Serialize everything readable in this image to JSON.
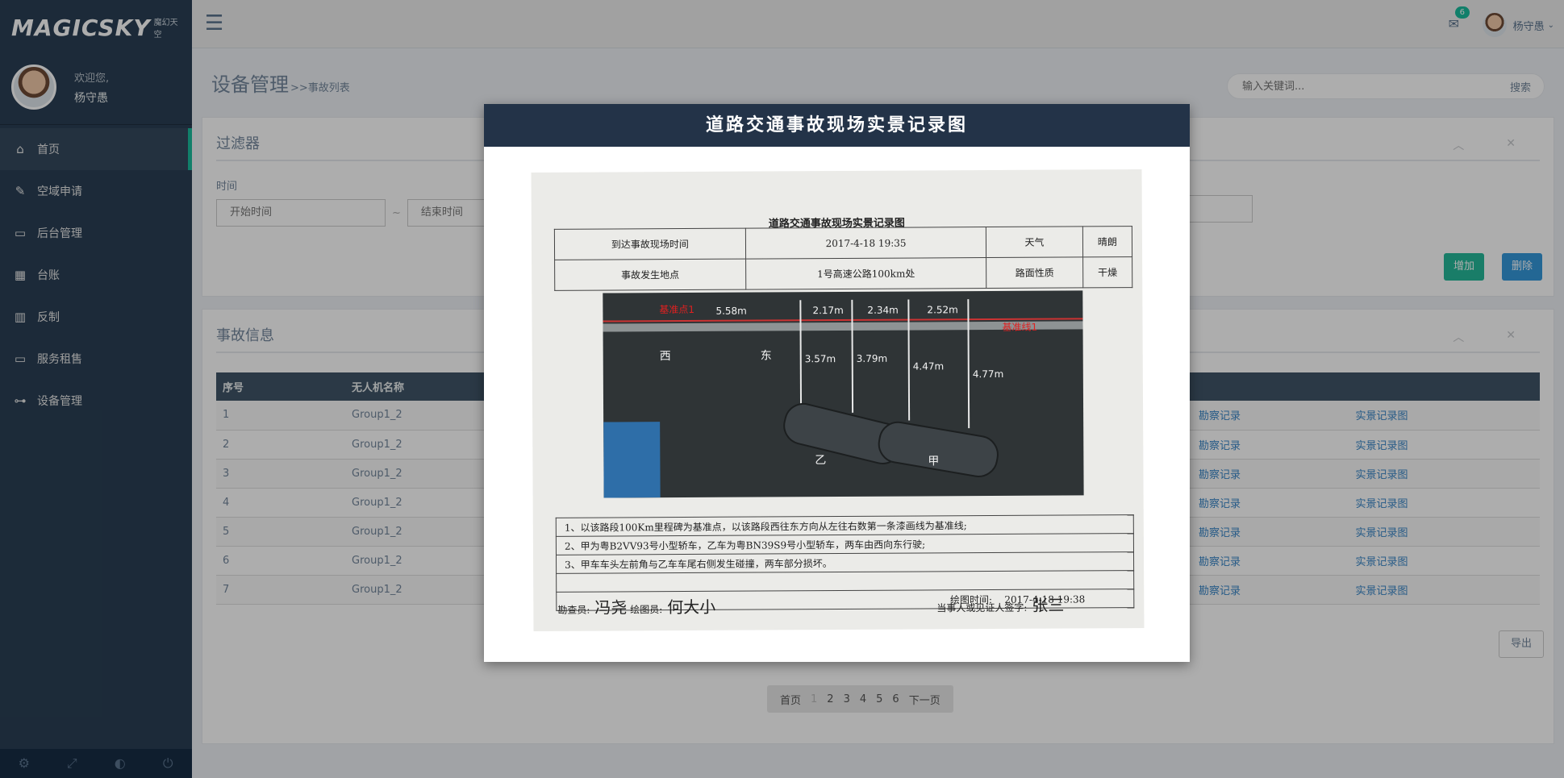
{
  "brand": {
    "logo": "MAGICSKY",
    "subtitle": "魔幻天空"
  },
  "profile": {
    "welcome": "欢迎您,",
    "name": "杨守愚"
  },
  "sidebar": {
    "items": [
      {
        "label": "首页",
        "icon": "home-icon"
      },
      {
        "label": "空域申请",
        "icon": "edit-icon"
      },
      {
        "label": "后台管理",
        "icon": "monitor-icon"
      },
      {
        "label": "台账",
        "icon": "table-icon"
      },
      {
        "label": "反制",
        "icon": "bar-chart-icon"
      },
      {
        "label": "服务租售",
        "icon": "laptop-icon"
      },
      {
        "label": "设备管理",
        "icon": "sitemap-icon"
      }
    ]
  },
  "topnav": {
    "mail_count": "6",
    "user_name": "杨守愚"
  },
  "page": {
    "title": "设备管理",
    "breadcrumb": ">>事故列表"
  },
  "search": {
    "placeholder": "输入关键词...",
    "button": "搜索"
  },
  "filter": {
    "title": "过滤器",
    "time_label": "时间",
    "start_placeholder": "开始时间",
    "end_placeholder": "结束时间",
    "range_sep": "~",
    "add_label": "增加",
    "delete_label": "删除"
  },
  "accident": {
    "title": "事故信息",
    "columns": [
      "序号",
      "无人机名称"
    ],
    "rows": [
      {
        "id": "1",
        "name": "Group1_2",
        "survey": "勘察记录",
        "scene": "实景记录图"
      },
      {
        "id": "2",
        "name": "Group1_2",
        "survey": "勘察记录",
        "scene": "实景记录图"
      },
      {
        "id": "3",
        "name": "Group1_2",
        "survey": "勘察记录",
        "scene": "实景记录图"
      },
      {
        "id": "4",
        "name": "Group1_2",
        "survey": "勘察记录",
        "scene": "实景记录图"
      },
      {
        "id": "5",
        "name": "Group1_2",
        "survey": "勘察记录",
        "scene": "实景记录图"
      },
      {
        "id": "6",
        "name": "Group1_2",
        "survey": "勘察记录",
        "scene": "实景记录图"
      },
      {
        "id": "7",
        "name": "Group1_2",
        "survey": "勘察记录",
        "scene": "实景记录图"
      }
    ],
    "export_label": "导出"
  },
  "pagination": {
    "first": "首页",
    "pages": [
      "1",
      "2",
      "3",
      "4",
      "5",
      "6"
    ],
    "next": "下一页"
  },
  "modal": {
    "title": "道路交通事故现场实景记录图",
    "paper_title": "道路交通事故现场实景记录图",
    "table": {
      "arrive_label": "到达事故现场时间",
      "arrive_value": "2017-4-18 19:35",
      "weather_label": "天气",
      "weather_value": "晴朗",
      "location_label": "事故发生地点",
      "location_value": "1号高速公路100km处",
      "road_label": "路面性质",
      "road_value": "干燥"
    },
    "diagram": {
      "ref_point": "基准点1",
      "ref_line": "基准线1",
      "west": "西",
      "east": "东",
      "d1": "5.58m",
      "d2": "2.17m",
      "d3": "2.34m",
      "d4": "2.52m",
      "v1": "3.57m",
      "v2": "3.79m",
      "v3": "4.47m",
      "v4": "4.77m",
      "car_a": "甲",
      "car_b": "乙"
    },
    "notes": [
      "1、以该路段100Km里程碑为基准点，以该路段西往东方向从左往右数第一条漆画线为基准线;",
      "2、甲为粤B2VV93号小型轿车，乙车为粤BN39S9号小型轿车，两车由西向东行驶;",
      "3、甲车车头左前角与乙车车尾右侧发生碰撞，两车部分损坏。",
      ""
    ],
    "draw_time_label": "绘图时间:",
    "draw_time_value": "2017-4-18 19:38",
    "surveyor_label": "勘查员:",
    "surveyor": "冯尧",
    "drawer_label": "绘图员:",
    "drawer": "何大小",
    "witness_label": "当事人或见证人签字:",
    "witness": "张三"
  }
}
